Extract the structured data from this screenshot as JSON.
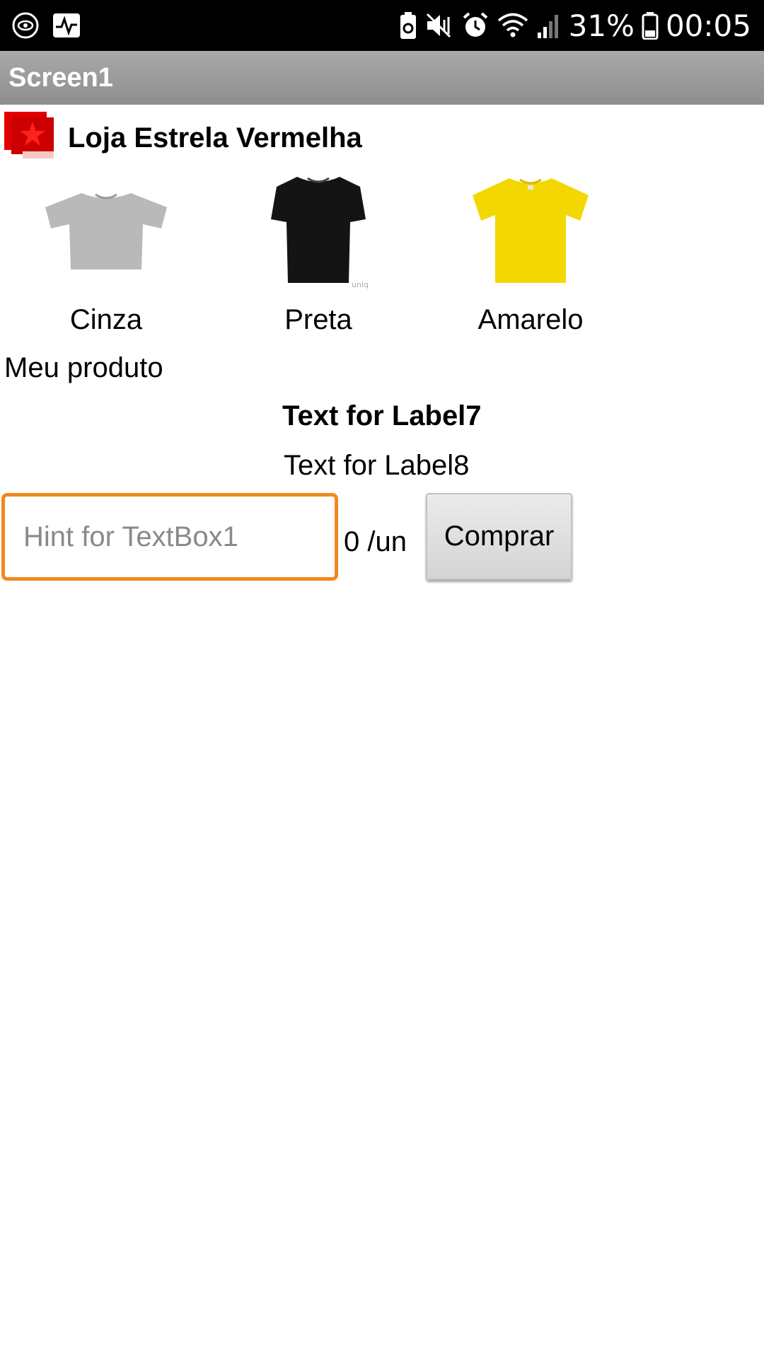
{
  "status_bar": {
    "left_icons": [
      "eye-chat-icon",
      "activity-monitor-icon"
    ],
    "right_icons": [
      "battery-saver-icon",
      "mute-vibrate-icon",
      "alarm-icon",
      "wifi-icon",
      "signal-icon"
    ],
    "battery_percent": "31%",
    "time": "00:05"
  },
  "title_bar": {
    "title": "Screen1"
  },
  "store": {
    "logo": "red-star-logo",
    "name": "Loja Estrela Vermelha"
  },
  "products": [
    {
      "label": "Cinza",
      "color": "#b8b8b8"
    },
    {
      "label": "Preta",
      "color": "#141414"
    },
    {
      "label": "Amarelo",
      "color": "#f2d800"
    }
  ],
  "labels": {
    "product_heading": "Meu produto",
    "label7": "Text for Label7",
    "label8": "Text for Label8"
  },
  "purchase": {
    "textbox_placeholder": "Hint for TextBox1",
    "price_text": "0 /un",
    "buy_label": "Comprar"
  },
  "colors": {
    "accent_orange": "#f08a1c",
    "title_bar": "#999999",
    "logo_red": "#e00000"
  }
}
